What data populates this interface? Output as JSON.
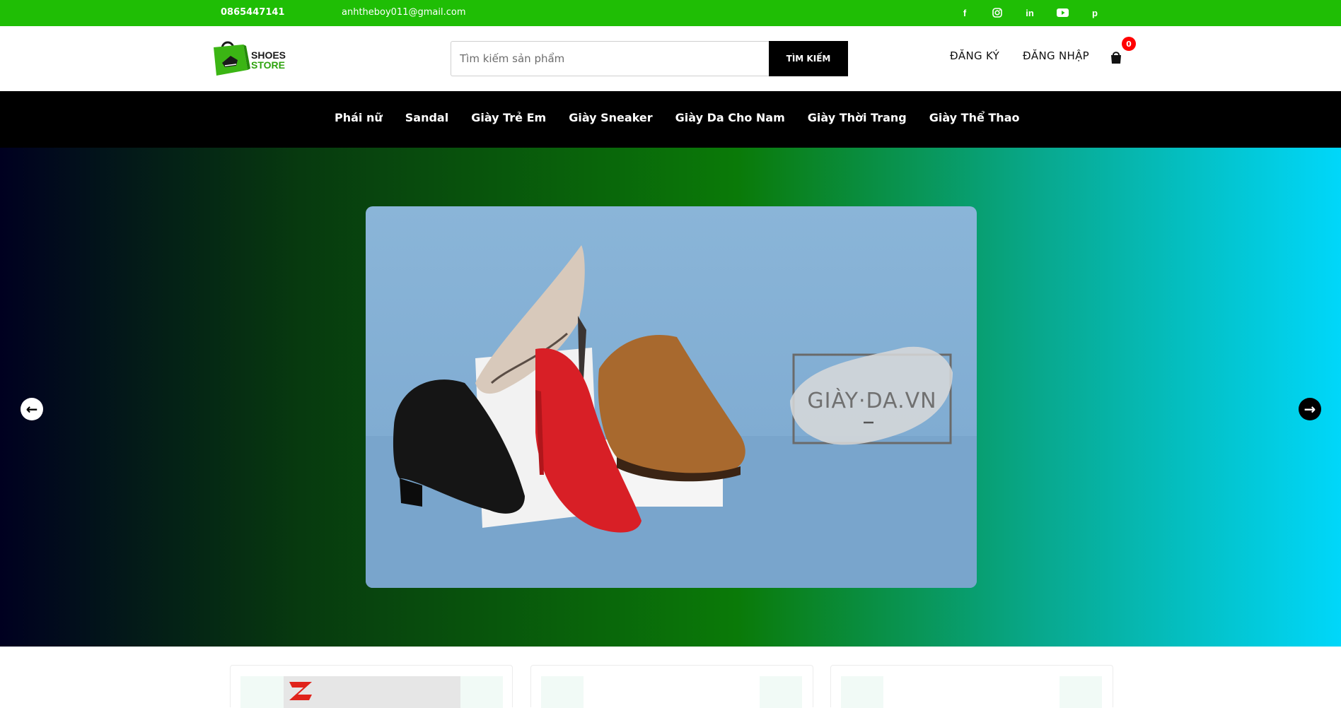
{
  "topbar": {
    "phone": "0865447141",
    "email": "anhtheboy011@gmail.com",
    "socials": [
      "facebook-icon",
      "instagram-icon",
      "linkedin-icon",
      "youtube-icon",
      "pinterest-icon"
    ]
  },
  "header": {
    "logo_line1": "SHOES",
    "logo_line2": "STORE",
    "search_placeholder": "Tìm kiếm sản phẩm",
    "search_button": "TÌM KIẾM",
    "register": "ĐĂNG KÝ",
    "login": "ĐĂNG NHẬP",
    "cart_count": "0"
  },
  "nav": {
    "items": [
      "Phái nữ",
      "Sandal",
      "Giày Trẻ Em",
      "Giày Sneaker",
      "Giày Da Cho Nam",
      "Giày Thời Trang",
      "Giày Thể Thao"
    ]
  },
  "hero": {
    "banner_watermark": "GIÀY·DA.VN",
    "prev_arrow": "←",
    "next_arrow": "→"
  },
  "colors": {
    "topbar": "#1fbe05",
    "nav": "#000000",
    "badge": "#ff0000",
    "brand_green": "#2ea30e"
  }
}
